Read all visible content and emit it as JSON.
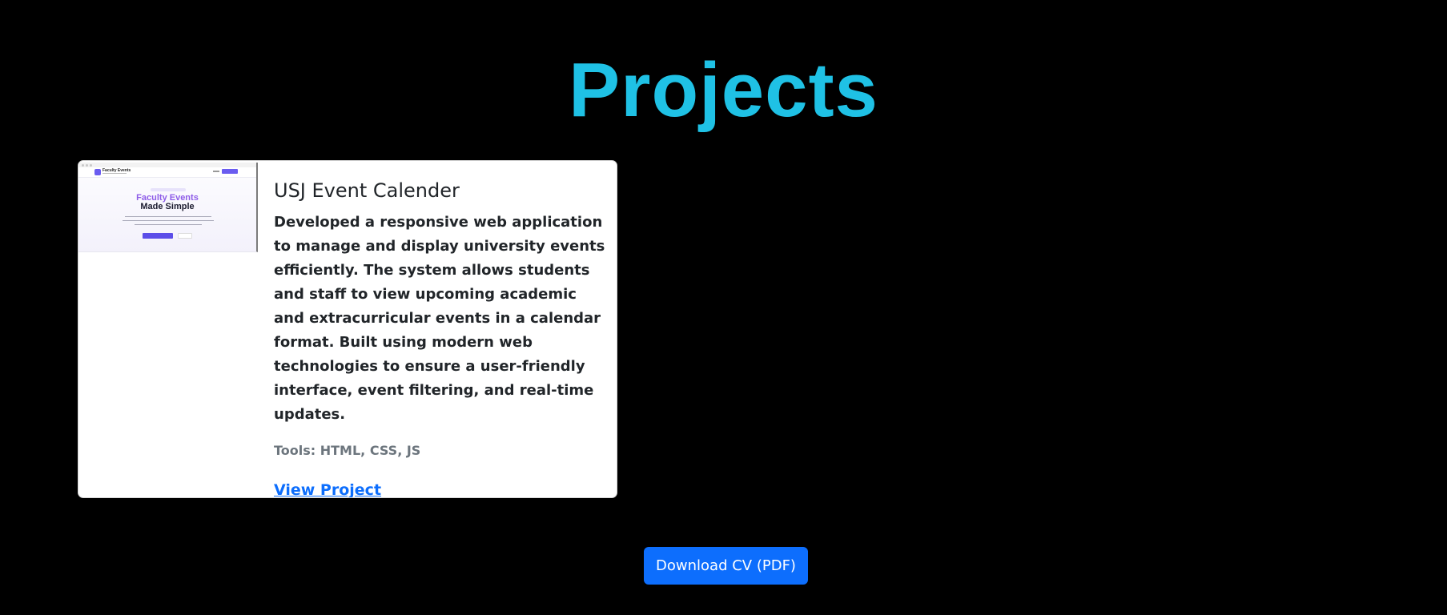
{
  "section": {
    "title": "Projects",
    "title_color": "#1fc1e5"
  },
  "projects": [
    {
      "thumbnail": {
        "brand": "Faculty Events",
        "headline_line1": "Faculty Events",
        "headline_line2": "Made Simple"
      },
      "title": "USJ Event Calender",
      "description": "Developed a responsive web application to manage and display university events efficiently. The system allows students and staff to view upcoming academic and extracurricular events in a calendar format. Built using modern web technologies to ensure a user-friendly interface, event filtering, and real-time updates.",
      "tools": "Tools: HTML, CSS, JS",
      "link_label": "View Project"
    }
  ],
  "cv_button": {
    "label": "Download CV (PDF)",
    "color": "#0d6efd"
  },
  "colors": {
    "background": "#000000",
    "card": "#ffffff",
    "link": "#0d6efd"
  }
}
